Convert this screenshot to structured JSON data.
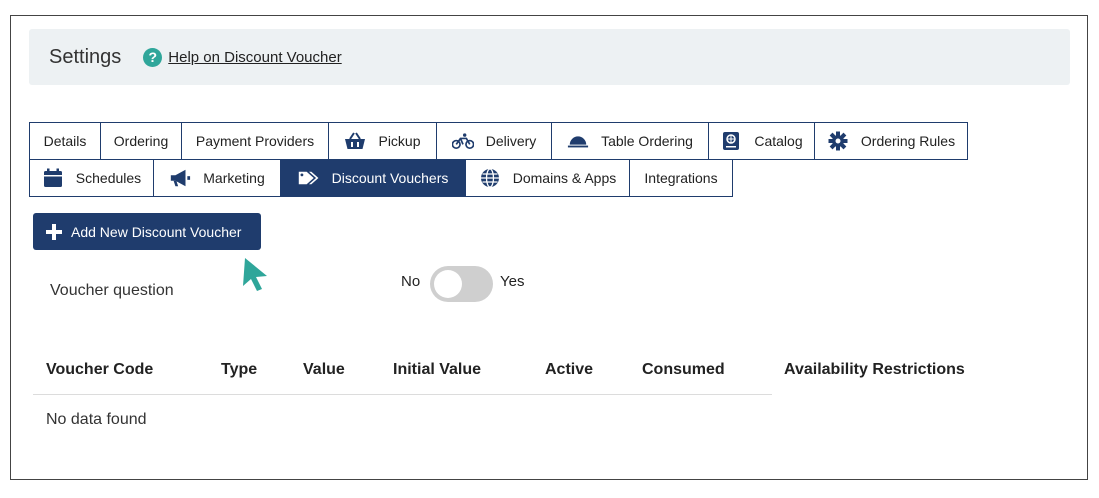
{
  "header": {
    "title": "Settings",
    "help_icon": "question-circle-icon",
    "help_link": "Help on Discount Voucher"
  },
  "tabs": [
    {
      "label": "Details",
      "icon": ""
    },
    {
      "label": "Ordering",
      "icon": ""
    },
    {
      "label": "Payment Providers",
      "icon": ""
    },
    {
      "label": "Pickup",
      "icon": "basket-icon"
    },
    {
      "label": "Delivery",
      "icon": "bicycle-icon"
    },
    {
      "label": "Table Ordering",
      "icon": "cloche-icon"
    },
    {
      "label": "Catalog",
      "icon": "book-icon"
    },
    {
      "label": "Ordering Rules",
      "icon": "gear-icon"
    },
    {
      "label": "Schedules",
      "icon": "calendar-icon"
    },
    {
      "label": "Marketing",
      "icon": "megaphone-icon"
    },
    {
      "label": "Discount Vouchers",
      "icon": "tags-icon",
      "active": true
    },
    {
      "label": "Domains & Apps",
      "icon": "globe-icon"
    },
    {
      "label": "Integrations",
      "icon": ""
    }
  ],
  "add_button": {
    "label": "Add New Discount Voucher"
  },
  "voucher_question": {
    "label": "Voucher question",
    "no_label": "No",
    "yes_label": "Yes",
    "value": false
  },
  "table": {
    "columns": [
      "Voucher Code",
      "Type",
      "Value",
      "Initial Value",
      "Active",
      "Consumed",
      "Availability Restrictions"
    ],
    "empty_message": "No data found"
  },
  "colors": {
    "primary": "#1f3c6d",
    "accent": "#2fa69a",
    "header_bg": "#edf1f3",
    "toggle_off": "#cfcfcf"
  }
}
